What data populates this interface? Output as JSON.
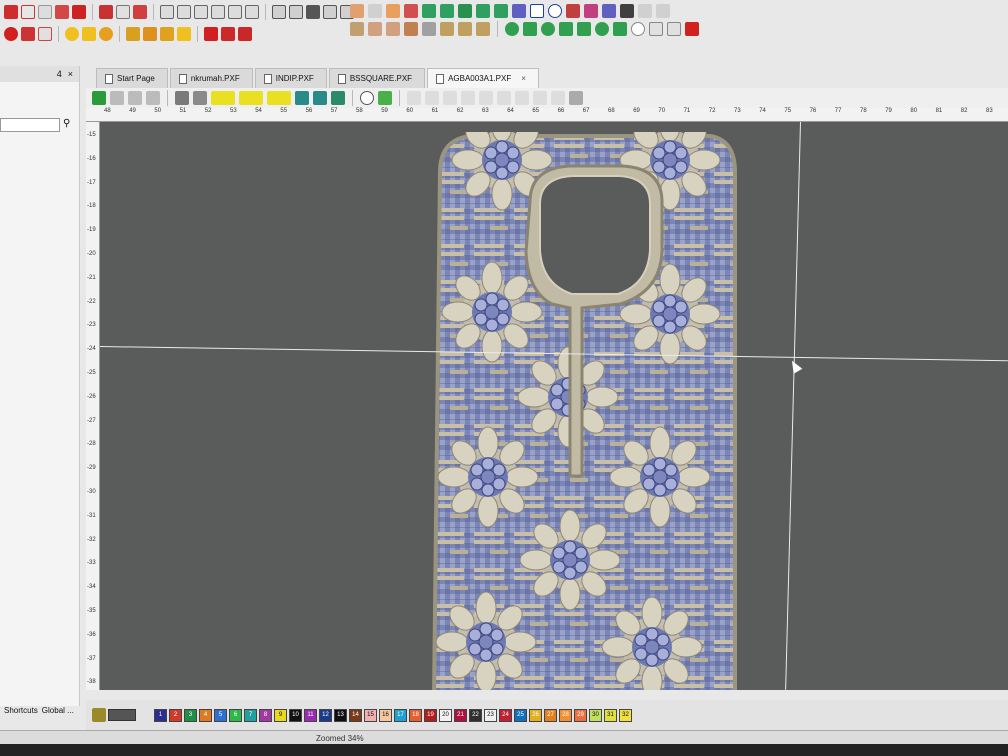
{
  "tabs": [
    {
      "label": "Start Page"
    },
    {
      "label": "nkrumah.PXF"
    },
    {
      "label": "INDIP.PXF"
    },
    {
      "label": "BSSQUARE.PXF"
    },
    {
      "label": "AGBA003A1.PXF",
      "active": true
    }
  ],
  "left_panel": {
    "pin": "4",
    "close": "×"
  },
  "ruler_h": [
    "48",
    "49",
    "50",
    "51",
    "52",
    "53",
    "54",
    "55",
    "56",
    "57",
    "58",
    "59",
    "60",
    "61",
    "62",
    "63",
    "64",
    "65",
    "66",
    "67",
    "68",
    "69",
    "70",
    "71",
    "72",
    "73",
    "74",
    "75",
    "76",
    "77",
    "78",
    "79",
    "80",
    "81",
    "82",
    "83"
  ],
  "ruler_v": [
    "-15",
    "-16",
    "-17",
    "-18",
    "-19",
    "-20",
    "-21",
    "-22",
    "-23",
    "-24",
    "-25",
    "-26",
    "-27",
    "-28",
    "-29",
    "-30",
    "-31",
    "-32",
    "-33",
    "-34",
    "-35",
    "-36",
    "-37",
    "-38"
  ],
  "palette": [
    "1",
    "2",
    "3",
    "4",
    "5",
    "6",
    "7",
    "8",
    "9",
    "10",
    "11",
    "12",
    "13",
    "14",
    "15",
    "16",
    "17",
    "18",
    "19",
    "20",
    "21",
    "22",
    "23",
    "24",
    "25",
    "26",
    "27",
    "28",
    "29",
    "30",
    "31",
    "32"
  ],
  "palette_colors": [
    "#2b2f8f",
    "#d03a2a",
    "#1f8f4a",
    "#e07a1e",
    "#2f6fd0",
    "#2fb84a",
    "#22a0a0",
    "#a03aa0",
    "#e8d820",
    "#111111",
    "#9a2ab0",
    "#1a3a8a",
    "#101010",
    "#7a3a1a",
    "#f0b0b0",
    "#f7c8a0",
    "#20a0d0",
    "#e06030",
    "#b02020",
    "#f2f2f2",
    "#b01040",
    "#303030",
    "#f0f0f0",
    "#c02030",
    "#1070c0",
    "#e0b020",
    "#e08020",
    "#f09030",
    "#e87040",
    "#c0e060",
    "#e0e040",
    "#f0e040"
  ],
  "panel_tabs": [
    "Shortcuts",
    "Global ..."
  ],
  "status": {
    "zoom": "Zoomed 34%"
  }
}
